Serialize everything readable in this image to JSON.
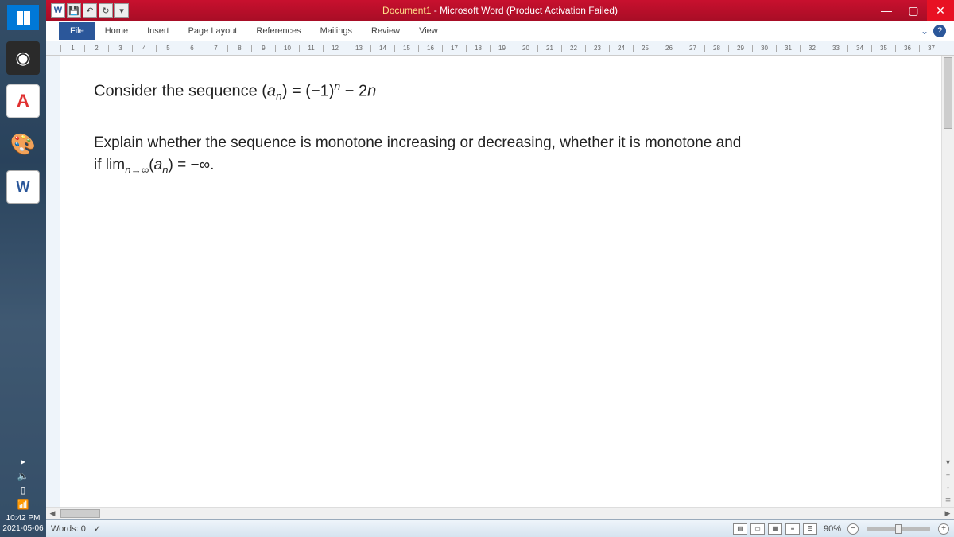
{
  "taskbar": {
    "clock_time": "10:42 PM",
    "clock_date": "2021-05-06",
    "pdf_label": "A",
    "word_label": "W",
    "paint_emoji": "🎨",
    "eye_glyph": "◉",
    "sound_glyph": "🔈",
    "battery_glyph": "▯",
    "signal_glyph": "📶",
    "expand_glyph": "▸"
  },
  "title": {
    "doc": "Document1",
    "sep": " - ",
    "app": "Microsoft Word (Product Activation Failed)"
  },
  "qat": {
    "word": "W",
    "save": "💾",
    "undo": "↶",
    "redo": "↻",
    "more": "▾"
  },
  "winctrls": {
    "min": "—",
    "max": "▢",
    "close": "✕"
  },
  "tabs": {
    "file": "File",
    "home": "Home",
    "insert": "Insert",
    "page_layout": "Page Layout",
    "references": "References",
    "mailings": "Mailings",
    "review": "Review",
    "view": "View"
  },
  "ribbon_right": {
    "collapse": "⌄",
    "help": "?"
  },
  "ruler_max": 37,
  "document": {
    "l1a": "Consider the sequence (",
    "l1b": ") = (−1)",
    "l1c": " − 2",
    "l2": "Explain whether the sequence is monotone increasing or decreasing, whether it is monotone and",
    "l3a": "if lim",
    "l3b": "(",
    "l3c": ") = −∞.",
    "a": "a",
    "n": "n",
    "sub_ninf": "n→∞"
  },
  "status": {
    "words": "Words: 0",
    "spell": "✓",
    "zoom": "90%",
    "minus": "−",
    "plus": "+"
  },
  "scroll": {
    "up": "▲",
    "down": "▼",
    "left": "◀",
    "right": "▶",
    "pgup": "±",
    "obj": "◦",
    "pgdn": "∓"
  }
}
